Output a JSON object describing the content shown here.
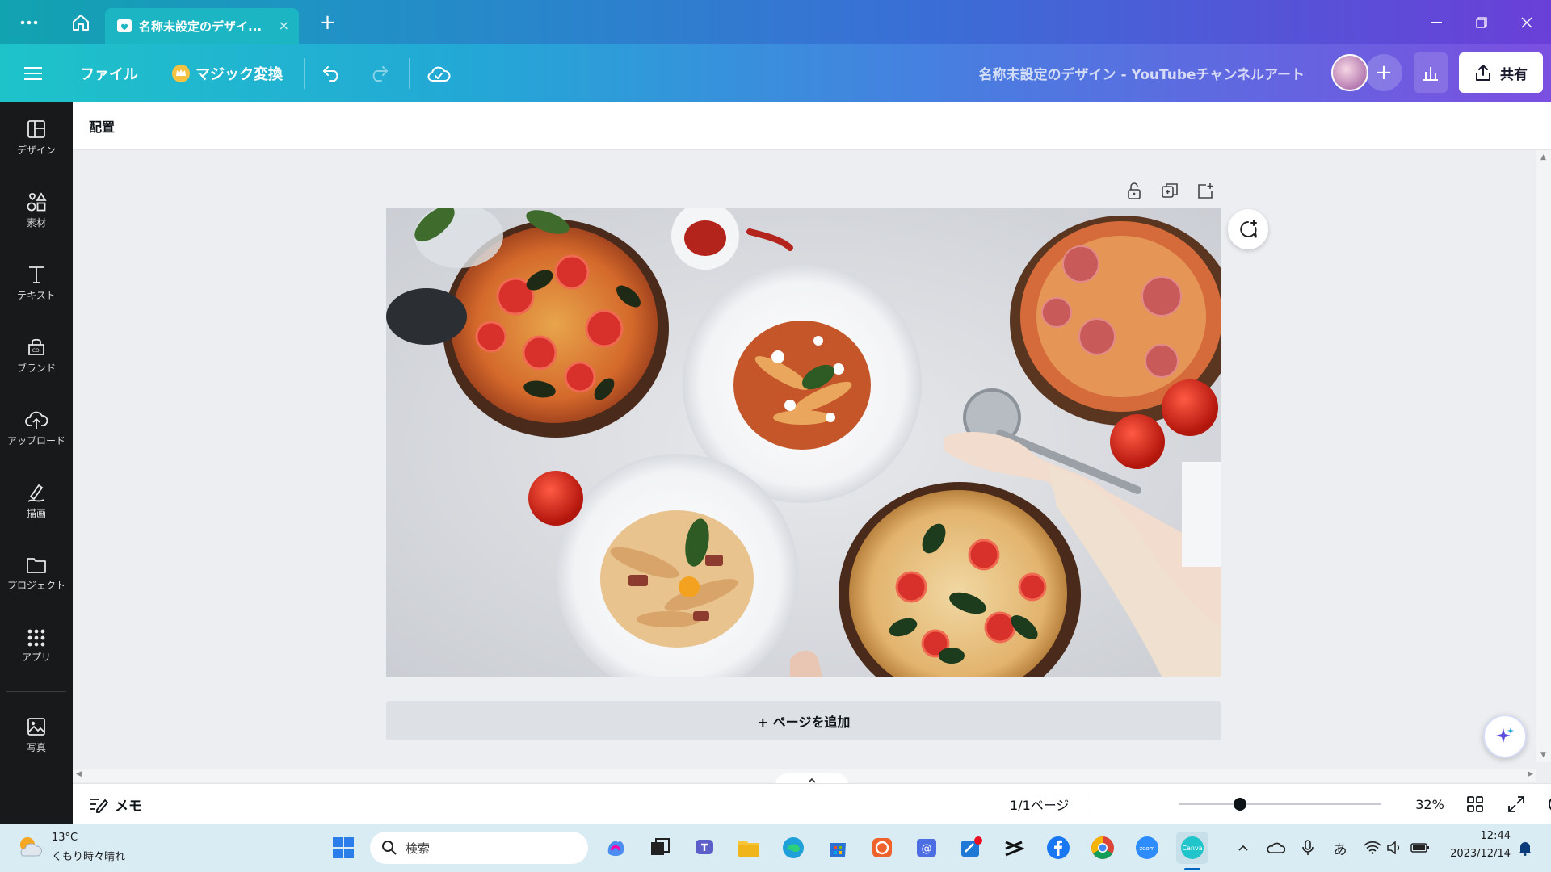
{
  "browser": {
    "tab_title": "名称未設定のデザイ...",
    "tab_close": "×",
    "new_tab": "+"
  },
  "toolbar": {
    "file_label": "ファイル",
    "magic_label": "マジック変換",
    "doc_title": "名称未設定のデザイン - YouTubeチャンネルアート",
    "share_label": "共有",
    "add_collaborator": "+"
  },
  "sidebar": {
    "items": [
      {
        "label": "デザイン",
        "icon": "layout-icon"
      },
      {
        "label": "素材",
        "icon": "elements-icon"
      },
      {
        "label": "テキスト",
        "icon": "text-icon"
      },
      {
        "label": "ブランド",
        "icon": "brand-icon"
      },
      {
        "label": "アップロード",
        "icon": "upload-icon"
      },
      {
        "label": "描画",
        "icon": "draw-icon"
      },
      {
        "label": "プロジェクト",
        "icon": "folder-icon"
      },
      {
        "label": "アプリ",
        "icon": "apps-icon"
      },
      {
        "label": "写真",
        "icon": "photo-icon"
      }
    ]
  },
  "context": {
    "arrange_label": "配置"
  },
  "canvas": {
    "add_page_label": "+ ページを追加"
  },
  "footer": {
    "notes_label": "メモ",
    "page_indicator": "1/1ページ",
    "zoom_level": "32%",
    "zoom_fraction": 0.3
  },
  "taskbar": {
    "weather_temp": "13°C",
    "weather_desc": "くもり時々晴れ",
    "search_placeholder": "検索",
    "ime_label": "あ",
    "time": "12:44",
    "date": "2023/12/14"
  },
  "colors": {
    "toolbar_start": "#1ec3c9",
    "toolbar_end": "#7b4fe0",
    "sidebar_bg": "#18191b"
  }
}
